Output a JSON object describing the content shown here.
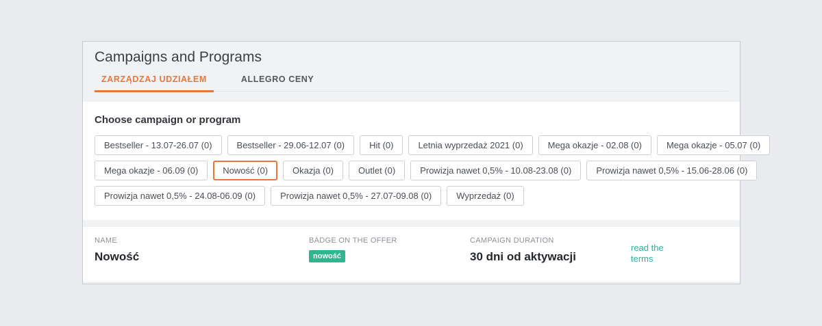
{
  "window": {
    "title": "Campaigns and Programs"
  },
  "tabs": [
    {
      "label": "ZARZĄDZAJ UDZIAŁEM",
      "active": true
    },
    {
      "label": "ALLEGRO CENY",
      "active": false
    }
  ],
  "campaign_picker": {
    "heading": "Choose campaign or program",
    "rows": [
      [
        {
          "label": "Bestseller - 13.07-26.07 (0)",
          "selected": false
        },
        {
          "label": "Bestseller - 29.06-12.07 (0)",
          "selected": false
        },
        {
          "label": "Hit (0)",
          "selected": false
        },
        {
          "label": "Letnia wyprzedaż 2021 (0)",
          "selected": false
        },
        {
          "label": "Mega okazje - 02.08 (0)",
          "selected": false
        },
        {
          "label": "Mega okazje - 05.07 (0)",
          "selected": false
        }
      ],
      [
        {
          "label": "Mega okazje - 06.09 (0)",
          "selected": false
        },
        {
          "label": "Nowość (0)",
          "selected": true
        },
        {
          "label": "Okazja (0)",
          "selected": false
        },
        {
          "label": "Outlet (0)",
          "selected": false
        },
        {
          "label": "Prowizja nawet 0,5% - 10.08-23.08 (0)",
          "selected": false
        },
        {
          "label": "Prowizja nawet 0,5% - 15.06-28.06 (0)",
          "selected": false
        }
      ],
      [
        {
          "label": "Prowizja nawet 0,5% - 24.08-06.09 (0)",
          "selected": false
        },
        {
          "label": "Prowizja nawet 0,5% - 27.07-09.08 (0)",
          "selected": false
        },
        {
          "label": "Wyprzedaż (0)",
          "selected": false
        }
      ]
    ]
  },
  "details": {
    "name": {
      "label": "NAME",
      "value": "Nowość"
    },
    "badge": {
      "label": "BADGE ON THE OFFER",
      "text": "nowość"
    },
    "duration": {
      "label": "CAMPAIGN DURATION",
      "value": "30 dni od aktywacji"
    },
    "terms_link_label": "read the terms"
  },
  "colors": {
    "accent_orange": "#eb7637",
    "badge_teal": "#2eb68e",
    "link_teal": "#2ab3a3"
  }
}
